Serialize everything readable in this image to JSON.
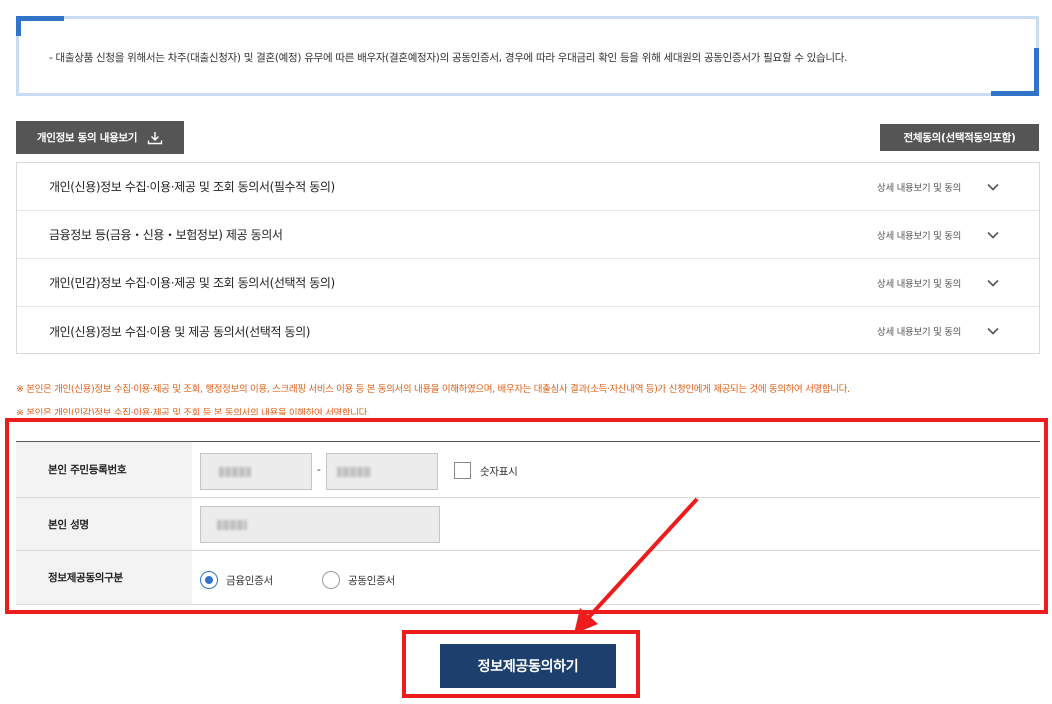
{
  "notice": {
    "text": "- 대출상품 신청을 위해서는 차주(대출신청자) 및 결혼(예정) 유무에 따른 배우자(결혼예정자)의 공동인증서, 경우에 따라 우대금리 확인 등을 위해 세대원의 공동인증서가 필요할 수 있습니다."
  },
  "buttons": {
    "view_consent": "개인정보 동의 내용보기",
    "agree_all": "전체동의(선택적동의포함)"
  },
  "accordion": {
    "items": [
      {
        "title": "개인(신용)정보 수집·이용·제공 및 조회 동의서(필수적 동의)",
        "detail": "상세 내용보기 및 동의"
      },
      {
        "title": "금융정보 등(금융・신용・보험정보) 제공 동의서",
        "detail": "상세 내용보기 및 동의"
      },
      {
        "title": "개인(민감)정보 수집·이용·제공 및 조회 동의서(선택적 동의)",
        "detail": "상세 내용보기 및 동의"
      },
      {
        "title": "개인(신용)정보 수집·이용 및 제공 동의서(선택적 동의)",
        "detail": "상세 내용보기 및 동의"
      }
    ]
  },
  "warnings": {
    "line1": "※ 본인은 개인(신용)정보 수집·이용·제공 및 조회, 행정정보의 이용, 스크래핑 서비스 이용 등 본 동의서의 내용을 이해하였으며, 배우자는 대출심사 결과(소득·자산내역 등)가 신청인에게 제공되는 것에 동의하여 서명합니다.",
    "line2": "※ 본인은 개인(민감)정보 수집·이용·제공 및 조회 등 본 동의서의 내용을 이해하여 서명합니다."
  },
  "form": {
    "rrn_label": "본인 주민등록번호",
    "rrn_separator": "-",
    "show_digits_label": "숫자표시",
    "name_label": "본인 성명",
    "consent_type_label": "정보제공동의구분",
    "radio_financial": "금융인증서",
    "radio_joint": "공동인증서",
    "selected": "금융인증서"
  },
  "submit": {
    "label": "정보제공동의하기"
  },
  "colors": {
    "highlight": "#ee1c1c",
    "submit_bg": "#1d3f6e",
    "accent": "#2f74c9",
    "warning": "#e0621a"
  }
}
